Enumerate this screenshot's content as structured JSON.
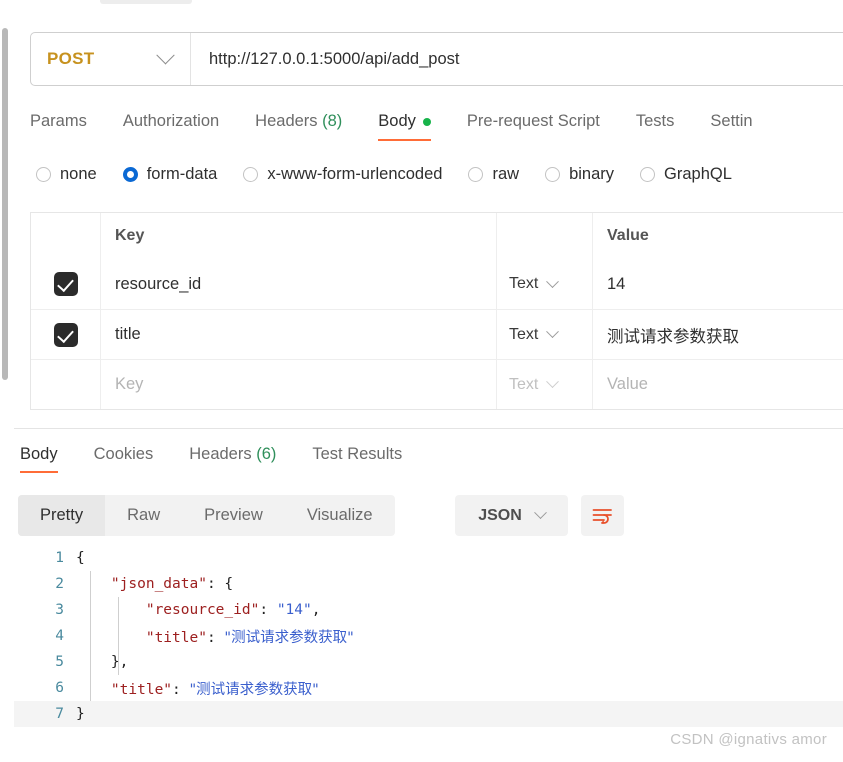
{
  "request": {
    "method": "POST",
    "url": "http://127.0.0.1:5000/api/add_post",
    "tabs": [
      {
        "label": "Params",
        "active": false
      },
      {
        "label": "Authorization",
        "active": false
      },
      {
        "label": "Headers",
        "count": "(8)",
        "active": false
      },
      {
        "label": "Body",
        "active": true,
        "dot": true
      },
      {
        "label": "Pre-request Script",
        "active": false
      },
      {
        "label": "Tests",
        "active": false
      },
      {
        "label": "Settin",
        "active": false
      }
    ],
    "body_types": [
      {
        "label": "none",
        "selected": false
      },
      {
        "label": "form-data",
        "selected": true
      },
      {
        "label": "x-www-form-urlencoded",
        "selected": false
      },
      {
        "label": "raw",
        "selected": false
      },
      {
        "label": "binary",
        "selected": false
      },
      {
        "label": "GraphQL",
        "selected": false
      }
    ],
    "table": {
      "headers": {
        "key": "Key",
        "value": "Value"
      },
      "rows": [
        {
          "checked": true,
          "key": "resource_id",
          "type": "Text",
          "value": "14",
          "placeholder": false
        },
        {
          "checked": true,
          "key": "title",
          "type": "Text",
          "value": "测试请求参数获取",
          "placeholder": false
        },
        {
          "checked": false,
          "key": "Key",
          "type": "Text",
          "value": "Value",
          "placeholder": true
        }
      ]
    }
  },
  "response": {
    "tabs": [
      {
        "label": "Body",
        "active": true
      },
      {
        "label": "Cookies",
        "active": false
      },
      {
        "label": "Headers",
        "count": "(6)",
        "active": false
      },
      {
        "label": "Test Results",
        "active": false
      }
    ],
    "view_modes": [
      {
        "label": "Pretty",
        "active": true
      },
      {
        "label": "Raw",
        "active": false
      },
      {
        "label": "Preview",
        "active": false
      },
      {
        "label": "Visualize",
        "active": false
      }
    ],
    "format": "JSON",
    "wrap_icon": "wrap-text-icon",
    "code_lines": [
      {
        "no": "1",
        "indent": 0,
        "segments": [
          {
            "t": "{",
            "c": "p"
          }
        ]
      },
      {
        "no": "2",
        "indent": 1,
        "segments": [
          {
            "t": "\"json_data\"",
            "c": "k"
          },
          {
            "t": ": {",
            "c": "p"
          }
        ]
      },
      {
        "no": "3",
        "indent": 2,
        "segments": [
          {
            "t": "\"resource_id\"",
            "c": "k"
          },
          {
            "t": ": ",
            "c": "p"
          },
          {
            "t": "\"14\"",
            "c": "s"
          },
          {
            "t": ",",
            "c": "p"
          }
        ]
      },
      {
        "no": "4",
        "indent": 2,
        "segments": [
          {
            "t": "\"title\"",
            "c": "k"
          },
          {
            "t": ": ",
            "c": "p"
          },
          {
            "t": "\"测试请求参数获取\"",
            "c": "s cjk"
          }
        ]
      },
      {
        "no": "5",
        "indent": 1,
        "segments": [
          {
            "t": "},",
            "c": "p"
          }
        ]
      },
      {
        "no": "6",
        "indent": 1,
        "segments": [
          {
            "t": "\"title\"",
            "c": "k"
          },
          {
            "t": ": ",
            "c": "p"
          },
          {
            "t": "\"测试请求参数获取\"",
            "c": "s cjk"
          }
        ]
      },
      {
        "no": "7",
        "indent": 0,
        "segments": [
          {
            "t": "}",
            "c": "p"
          }
        ],
        "highlight": true
      }
    ]
  },
  "watermark": "CSDN @ignativs  amor",
  "colors": {
    "accent": "#ff6c37",
    "method": "#c7921f",
    "radio_selected": "#0b69d4",
    "count_green": "#2f8f5b",
    "dot_green": "#17b34a"
  }
}
